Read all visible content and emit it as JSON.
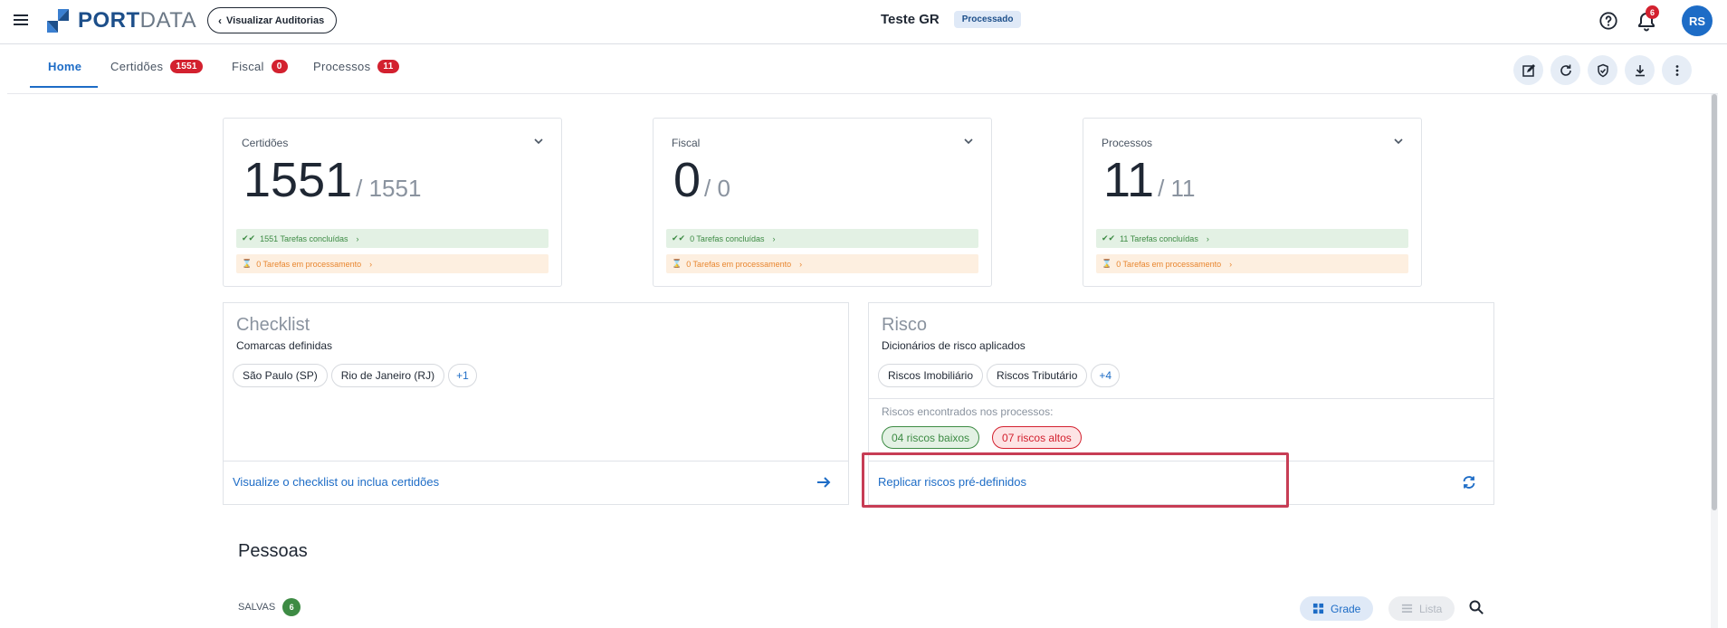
{
  "header": {
    "logo_text_bold": "PORT",
    "logo_text_light": "DATA",
    "back_button_label": "Visualizar Auditorias",
    "title": "Teste GR",
    "status": "Processado",
    "notifications_count": "6",
    "avatar_initials": "RS"
  },
  "tabs": [
    {
      "label": "Home",
      "badge": null
    },
    {
      "label": "Certidões",
      "badge": "1551"
    },
    {
      "label": "Fiscal",
      "badge": "0"
    },
    {
      "label": "Processos",
      "badge": "11"
    }
  ],
  "toolbar": {
    "icons": [
      "edit-icon",
      "refresh-icon",
      "shield-check-icon",
      "download-icon",
      "more-vert-icon"
    ]
  },
  "stats": [
    {
      "label": "Certidões",
      "value": "1551",
      "total": "/ 1551",
      "done": "1551 Tarefas concluídas",
      "processing": "0 Tarefas em processamento"
    },
    {
      "label": "Fiscal",
      "value": "0",
      "total": "/ 0",
      "done": "0 Tarefas concluídas",
      "processing": "0 Tarefas em processamento"
    },
    {
      "label": "Processos",
      "value": "11",
      "total": "/ 11",
      "done": "11 Tarefas concluídas",
      "processing": "0 Tarefas em processamento"
    }
  ],
  "checklist": {
    "title": "Checklist",
    "subtitle": "Comarcas definidas",
    "chips": [
      "São Paulo (SP)",
      "Rio de Janeiro (RJ)",
      "+1"
    ],
    "footer_link": "Visualize o checklist ou inclua certidões"
  },
  "risco": {
    "title": "Risco",
    "subtitle": "Dicionários de risco aplicados",
    "chips": [
      "Riscos Imobiliário",
      "Riscos Tributário",
      "+4"
    ],
    "found_label": "Riscos encontrados nos processos:",
    "low": "04 riscos baixos",
    "high": "07 riscos altos",
    "footer_link": "Replicar riscos pré-definidos"
  },
  "pessoas": {
    "title": "Pessoas",
    "salvas_label": "SALVAS",
    "salvas_count": "6",
    "view_grade": "Grade",
    "view_lista": "Lista"
  },
  "colors": {
    "accent": "#1d6cc6",
    "danger": "#d3212f",
    "success": "#3d8b44",
    "warning": "#e8862f",
    "highlight": "#c73d55"
  }
}
